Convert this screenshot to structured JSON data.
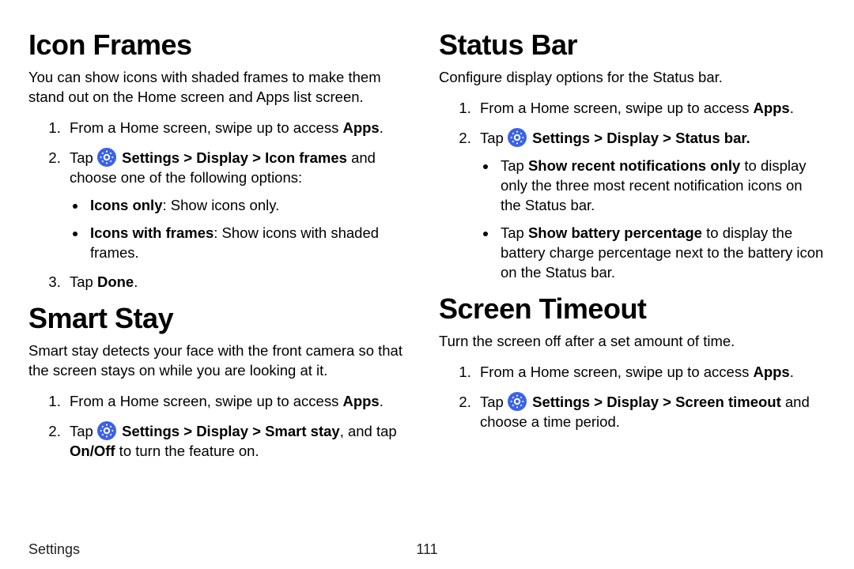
{
  "left": {
    "icon_frames": {
      "title": "Icon Frames",
      "intro": "You can show icons with shaded frames to make them stand out on the Home screen and Apps list screen.",
      "step1_a": "From a Home screen, swipe up to access ",
      "step1_b": "Apps",
      "step1_c": ".",
      "step2_a": "Tap ",
      "step2_b": "Settings",
      "gt1": " > ",
      "step2_c": "Display",
      "gt2": " > ",
      "step2_d": "Icon frames",
      "step2_e": " and choose one of the following options:",
      "opt1_a": "Icons only",
      "opt1_b": ": Show icons only.",
      "opt2_a": "Icons with frames",
      "opt2_b": ": Show icons with shaded frames.",
      "step3_a": "Tap ",
      "step3_b": "Done",
      "step3_c": "."
    },
    "smart_stay": {
      "title": "Smart Stay",
      "intro": "Smart stay detects your face with the front camera so that the screen stays on while you are looking at it.",
      "step1_a": "From a Home screen, swipe up to access ",
      "step1_b": "Apps",
      "step1_c": ".",
      "step2_a": "Tap ",
      "step2_b": "Settings",
      "gt1": " > ",
      "step2_c": "Display",
      "gt2": " > ",
      "step2_d": "Smart stay",
      "step2_e": ", and tap ",
      "step2_f": "On/Off",
      "step2_g": " to turn the feature on."
    }
  },
  "right": {
    "status_bar": {
      "title": "Status Bar",
      "intro": "Configure display options for the Status bar.",
      "step1_a": "From a Home screen, swipe up to access ",
      "step1_b": "Apps",
      "step1_c": ".",
      "step2_a": "Tap ",
      "step2_b": "Settings",
      "gt1": " > ",
      "step2_c": "Display",
      "gt2": " > ",
      "step2_d": "Status bar",
      "step2_e": ".",
      "opt1_a": "Tap ",
      "opt1_b": "Show recent notifications only",
      "opt1_c": " to display only the three most recent notification icons on the Status bar.",
      "opt2_a": "Tap ",
      "opt2_b": "Show battery percentage",
      "opt2_c": " to display the battery charge percentage next to the battery icon on the Status bar."
    },
    "screen_timeout": {
      "title": "Screen Timeout",
      "intro": "Turn the screen off after a set amount of time.",
      "step1_a": "From a Home screen, swipe up to access ",
      "step1_b": "Apps",
      "step1_c": ".",
      "step2_a": "Tap ",
      "step2_b": "Settings",
      "gt1": " > ",
      "step2_c": "Display",
      "gt2": " > ",
      "step2_d": "Screen timeout",
      "step2_e": " and choose a time period."
    }
  },
  "footer": {
    "section": "Settings",
    "page": "111"
  }
}
